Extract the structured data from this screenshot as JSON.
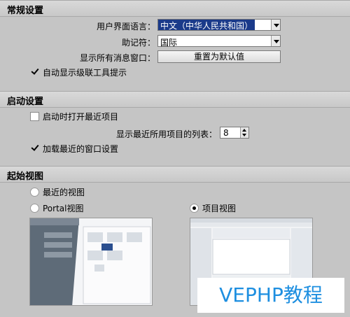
{
  "general": {
    "title": "常规设置",
    "ui_language_label": "用户界面语言：",
    "ui_language_value": "中文（中华人民共和国）",
    "mnemonic_label": "助记符：",
    "mnemonic_value": "国际",
    "show_messages_label": "显示所有消息窗口：",
    "reset_button": "重置为默认值",
    "auto_tooltip_label": "自动显示级联工具提示",
    "auto_tooltip_checked": true
  },
  "startup": {
    "title": "启动设置",
    "open_recent_label": "启动时打开最近项目",
    "open_recent_checked": false,
    "recent_list_label": "显示最近所用项目的列表：",
    "recent_list_value": "8",
    "load_window_label": "加载最近的窗口设置",
    "load_window_checked": true
  },
  "start_view": {
    "title": "起始视图",
    "recent_view_label": "最近的视图",
    "portal_view_label": "Portal视图",
    "project_view_label": "项目视图",
    "selected": "project"
  },
  "watermark": {
    "text": "VEPHP教程"
  }
}
